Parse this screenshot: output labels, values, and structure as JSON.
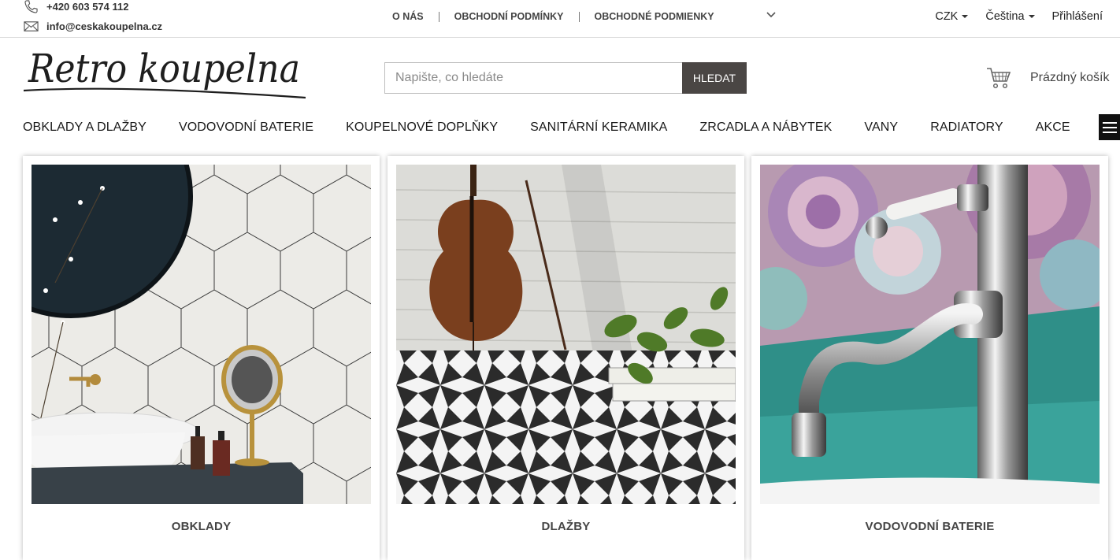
{
  "contact": {
    "phone": "+420 603 574 112",
    "email": "info@ceskakoupelna.cz"
  },
  "top_links": [
    "O NÁS",
    "OBCHODNÍ PODMÍNKY",
    "OBCHODNÉ PODMIENKY"
  ],
  "top_right": {
    "currency": "CZK",
    "language": "Čeština",
    "login": "Přihlášení"
  },
  "logo": {
    "text": "Retro koupelna"
  },
  "search": {
    "placeholder": "Napište, co hledáte",
    "button": "HLEDAT"
  },
  "cart": {
    "label": "Prázdný košík"
  },
  "nav": [
    "OBKLADY A DLAŽBY",
    "VODOVODNÍ BATERIE",
    "KOUPELNOVÉ DOPLŇKY",
    "SANITÁRNÍ KERAMIKA",
    "ZRCADLA A NÁBYTEK",
    "VANY",
    "RADIATORY",
    "AKCE"
  ],
  "categories": [
    {
      "label": "OBKLADY"
    },
    {
      "label": "DLAŽBY"
    },
    {
      "label": "VODOVODNÍ BATERIE"
    }
  ],
  "colors": {
    "button_bg": "#4a4644",
    "text": "#222222",
    "menu_button": "#111111"
  }
}
